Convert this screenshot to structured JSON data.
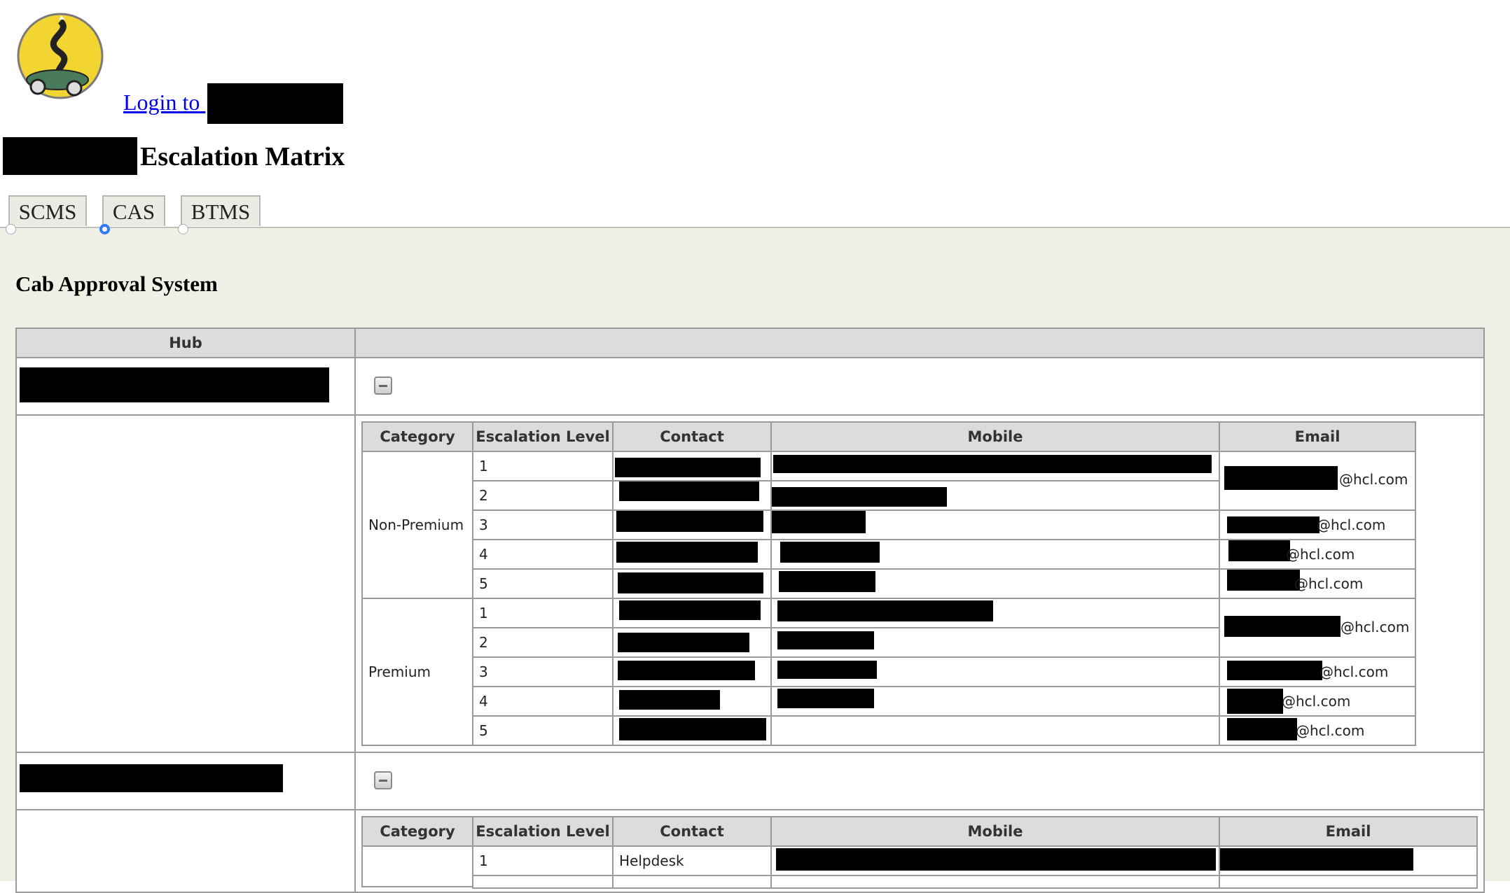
{
  "header": {
    "login_link": "Login to",
    "page_title": "Escalation Matrix"
  },
  "tabs": [
    {
      "label": "SCMS",
      "selected": false
    },
    {
      "label": "CAS",
      "selected": true
    },
    {
      "label": "BTMS",
      "selected": false
    }
  ],
  "section": {
    "title": "Cab Approval System",
    "hub_header": "Hub"
  },
  "detail_headers": {
    "category": "Category",
    "level": "Escalation Level",
    "contact": "Contact",
    "mobile": "Mobile",
    "email": "Email"
  },
  "hub1": {
    "categories": {
      "non_premium": "Non-Premium",
      "premium": "Premium"
    },
    "levels": [
      "1",
      "2",
      "3",
      "4",
      "5",
      "1",
      "2",
      "3",
      "4",
      "5"
    ],
    "email_suffixes": [
      "@hcl.com",
      "@hcl.com",
      "@hcl.com",
      "@hcl.com",
      "@hcl.com",
      "@hcl.com",
      "@hcl.com",
      "@hcl.com"
    ]
  },
  "hub2": {
    "rows": [
      {
        "level": "1",
        "contact": "Helpdesk"
      }
    ]
  },
  "colors": {
    "panel_bg": "#f1f0e6",
    "header_bg": "#dcdcdc",
    "link": "#0000ee",
    "radio_selected": "#2f7cf6"
  },
  "icons": [
    "car-logo-icon",
    "collapse-icon"
  ]
}
